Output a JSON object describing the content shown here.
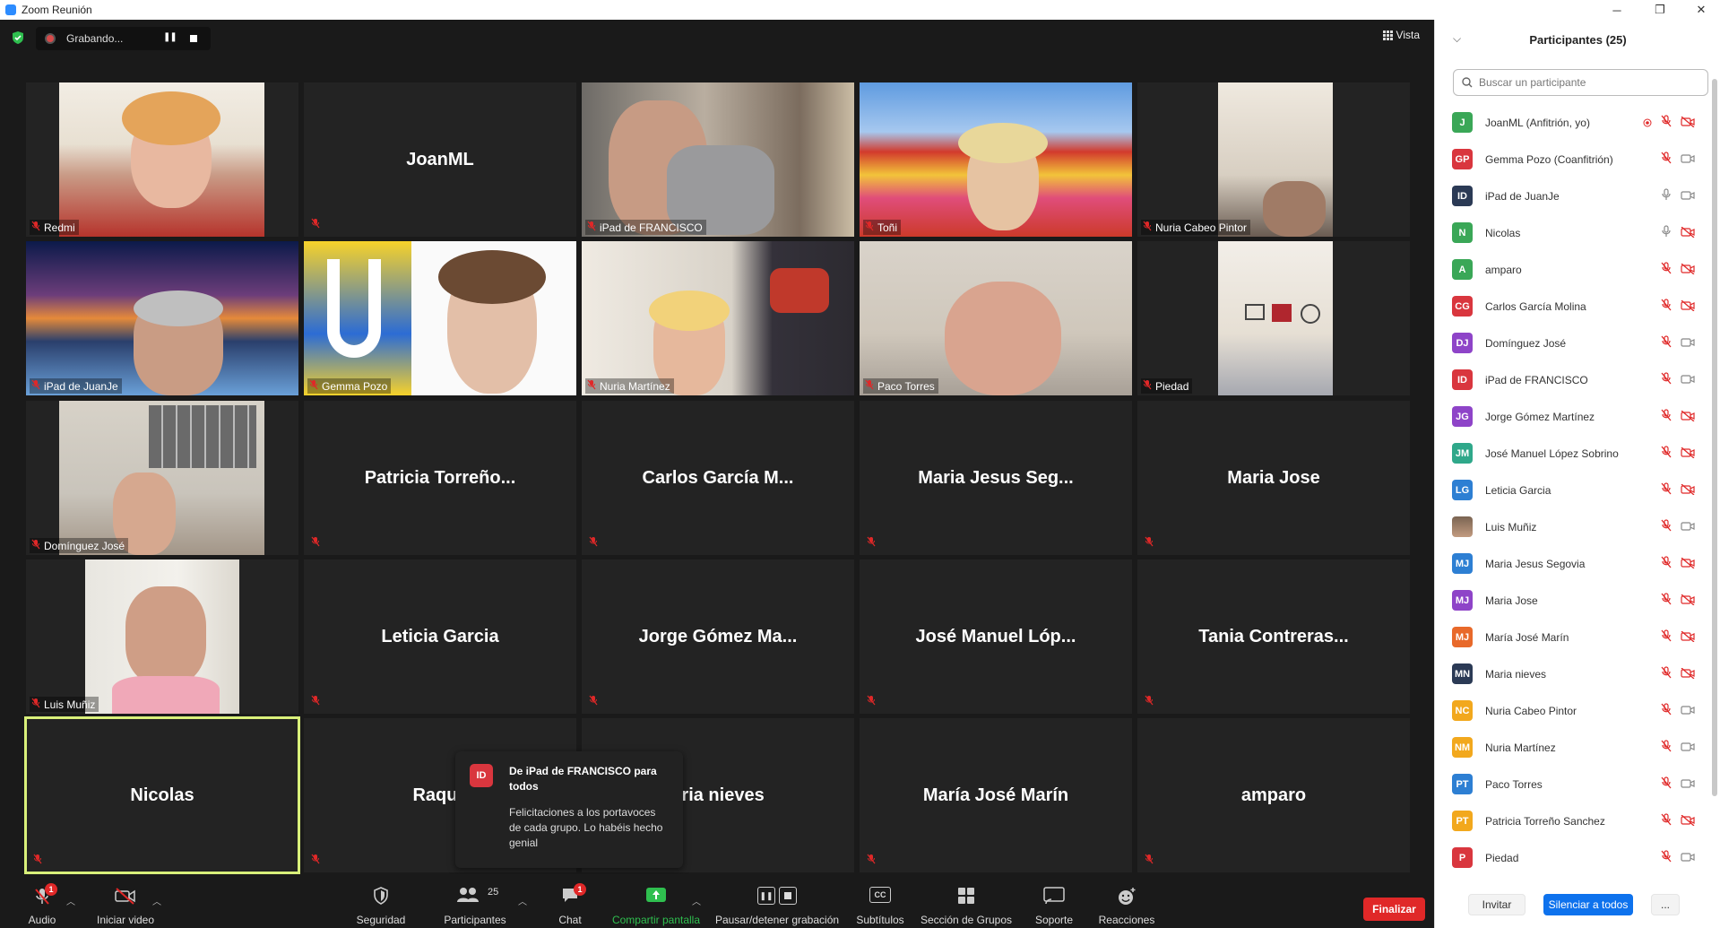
{
  "window": {
    "title": "Zoom Reunión"
  },
  "topbar": {
    "recording_label": "Grabando...",
    "view_label": "Vista"
  },
  "grid": [
    {
      "name": "Redmi",
      "video": "woman-glasses"
    },
    {
      "name": "JoanML",
      "video": null
    },
    {
      "name": "iPad de FRANCISCO",
      "video": "man-hand"
    },
    {
      "name": "Toñi",
      "video": "flowers-woman"
    },
    {
      "name": "Nuria Cabeo Pintor",
      "video": "room-ceiling"
    },
    {
      "name": "iPad de JuanJe",
      "video": "pier-man"
    },
    {
      "name": "Gemma Pozo",
      "video": "logo-woman"
    },
    {
      "name": "Nuria Martínez",
      "video": "up-woman"
    },
    {
      "name": "Paco Torres",
      "video": "bald-man"
    },
    {
      "name": "Piedad",
      "video": "wall-room"
    },
    {
      "name": "Domínguez José",
      "video": "photos-wall"
    },
    {
      "name": "Patricia Torreño...",
      "video": null
    },
    {
      "name": "Carlos García M...",
      "video": null
    },
    {
      "name": "Maria Jesus Seg...",
      "video": null
    },
    {
      "name": "Maria Jose",
      "video": null
    },
    {
      "name": "Luis Muñiz",
      "video": "office-man"
    },
    {
      "name": "Leticia Garcia",
      "video": null
    },
    {
      "name": "Jorge Gómez Ma...",
      "video": null
    },
    {
      "name": "José Manuel Lóp...",
      "video": null
    },
    {
      "name": "Tania Contreras...",
      "video": null
    },
    {
      "name": "Nicolas",
      "video": null
    },
    {
      "name": "Raque",
      "video": null
    },
    {
      "name": "aria nieves",
      "video": null
    },
    {
      "name": "María José Marín",
      "video": null
    },
    {
      "name": "amparo",
      "video": null
    }
  ],
  "toast": {
    "avatar": "ID",
    "title": "De iPad de FRANCISCO para todos",
    "message": "Felicitaciones a los portavoces de cada grupo. Lo habéis hecho genial"
  },
  "toolbar": {
    "audio": "Audio",
    "video": "Iniciar video",
    "security": "Seguridad",
    "participants": "Participantes",
    "participants_count": "25",
    "chat": "Chat",
    "chat_badge": "1",
    "audio_badge": "1",
    "share": "Compartir pantalla",
    "pause_rec": "Pausar/detener grabación",
    "subtitles": "Subtítulos",
    "groups": "Sección de Grupos",
    "support": "Soporte",
    "reactions": "Reacciones",
    "end": "Finalizar",
    "subtitles_cc": "CC"
  },
  "panel": {
    "title": "Participantes (25)",
    "search_placeholder": "Buscar un participante",
    "invite": "Invitar",
    "mute_all": "Silenciar a todos",
    "more": "...",
    "participants": [
      {
        "initials": "J",
        "name": "JoanML (Anfitrión, yo)",
        "color": "#3aa757",
        "mic": "muted",
        "cam": "off",
        "rec": true
      },
      {
        "initials": "GP",
        "name": "Gemma Pozo (Coanfitrión)",
        "color": "#d9363e",
        "mic": "muted",
        "cam": "on"
      },
      {
        "initials": "ID",
        "name": "iPad de JuanJe",
        "color": "#2b3a55",
        "mic": "on",
        "cam": "on"
      },
      {
        "initials": "N",
        "name": "Nicolas",
        "color": "#3aa757",
        "mic": "on",
        "cam": "off"
      },
      {
        "initials": "A",
        "name": "amparo",
        "color": "#3aa757",
        "mic": "muted",
        "cam": "off"
      },
      {
        "initials": "CG",
        "name": "Carlos García Molina",
        "color": "#d9363e",
        "mic": "muted",
        "cam": "off"
      },
      {
        "initials": "DJ",
        "name": "Domínguez José",
        "color": "#8e44c8",
        "mic": "muted",
        "cam": "on"
      },
      {
        "initials": "ID",
        "name": "iPad de FRANCISCO",
        "color": "#d9363e",
        "mic": "muted",
        "cam": "on"
      },
      {
        "initials": "JG",
        "name": "Jorge Gómez Martínez",
        "color": "#8e44c8",
        "mic": "muted",
        "cam": "off"
      },
      {
        "initials": "JM",
        "name": "José Manuel López Sobrino",
        "color": "#2fa88a",
        "mic": "muted",
        "cam": "off"
      },
      {
        "initials": "LG",
        "name": "Leticia Garcia",
        "color": "#2d7fd3",
        "mic": "muted",
        "cam": "off"
      },
      {
        "initials": "",
        "name": "Luis Muñiz",
        "color": "#a0866a",
        "mic": "muted",
        "cam": "on",
        "photo": true
      },
      {
        "initials": "MJ",
        "name": "Maria Jesus Segovia",
        "color": "#2d7fd3",
        "mic": "muted",
        "cam": "off"
      },
      {
        "initials": "MJ",
        "name": "Maria Jose",
        "color": "#8e44c8",
        "mic": "muted",
        "cam": "off"
      },
      {
        "initials": "MJ",
        "name": "María José Marín",
        "color": "#e8692a",
        "mic": "muted",
        "cam": "off"
      },
      {
        "initials": "MN",
        "name": "Maria nieves",
        "color": "#2b3a55",
        "mic": "muted",
        "cam": "off"
      },
      {
        "initials": "NC",
        "name": "Nuria Cabeo Pintor",
        "color": "#f2a81d",
        "mic": "muted",
        "cam": "on"
      },
      {
        "initials": "NM",
        "name": "Nuria Martínez",
        "color": "#f2a81d",
        "mic": "muted",
        "cam": "on"
      },
      {
        "initials": "PT",
        "name": "Paco Torres",
        "color": "#2d7fd3",
        "mic": "muted",
        "cam": "on"
      },
      {
        "initials": "PT",
        "name": "Patricia Torreño Sanchez",
        "color": "#f2a81d",
        "mic": "muted",
        "cam": "off"
      },
      {
        "initials": "P",
        "name": "Piedad",
        "color": "#d9363e",
        "mic": "muted",
        "cam": "on"
      }
    ]
  }
}
